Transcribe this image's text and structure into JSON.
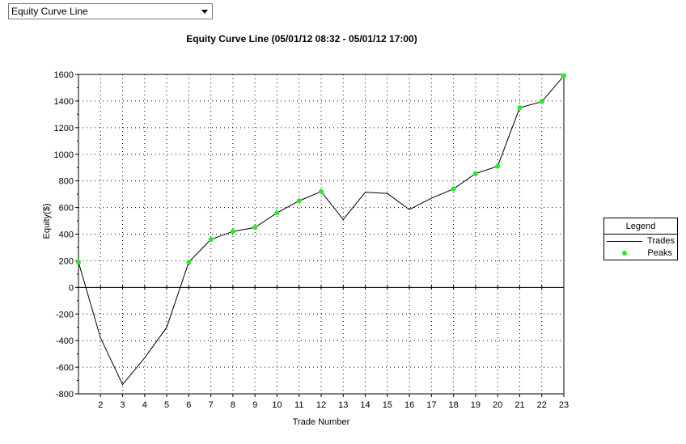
{
  "dropdown": {
    "value": "Equity Curve Line"
  },
  "colors": {
    "line": "#000000",
    "peak": "#22ee22",
    "grid": "#000000"
  },
  "chart_data": {
    "type": "line",
    "title": "Equity Curve Line (05/01/12 08:32 - 05/01/12 17:00)",
    "xlabel": "Trade Number",
    "ylabel": "Equity($)",
    "xlim": [
      1,
      23
    ],
    "ylim": [
      -800,
      1600
    ],
    "xticks": [
      2,
      3,
      4,
      5,
      6,
      7,
      8,
      9,
      10,
      11,
      12,
      13,
      14,
      15,
      16,
      17,
      18,
      19,
      20,
      21,
      22,
      23
    ],
    "yticks": [
      -800,
      -600,
      -400,
      -200,
      0,
      200,
      400,
      600,
      800,
      1000,
      1200,
      1400,
      1600
    ],
    "grid": true,
    "legend": {
      "title": "Legend",
      "placement": "right",
      "entries": [
        "Trades",
        "Peaks"
      ]
    },
    "series": [
      {
        "name": "Trades",
        "x": [
          1,
          2,
          3,
          4,
          5,
          6,
          7,
          8,
          9,
          10,
          11,
          12,
          13,
          14,
          15,
          16,
          17,
          18,
          19,
          20,
          21,
          22,
          23
        ],
        "y": [
          190,
          -380,
          -730,
          -530,
          -300,
          190,
          360,
          420,
          450,
          560,
          650,
          720,
          510,
          715,
          705,
          585,
          670,
          740,
          855,
          910,
          1350,
          1395,
          1590
        ]
      },
      {
        "name": "Peaks",
        "x": [
          1,
          6,
          7,
          8,
          9,
          10,
          11,
          12,
          18,
          19,
          20,
          21,
          22,
          23
        ],
        "y": [
          190,
          190,
          360,
          420,
          450,
          560,
          650,
          720,
          740,
          855,
          910,
          1350,
          1395,
          1590
        ]
      }
    ]
  }
}
